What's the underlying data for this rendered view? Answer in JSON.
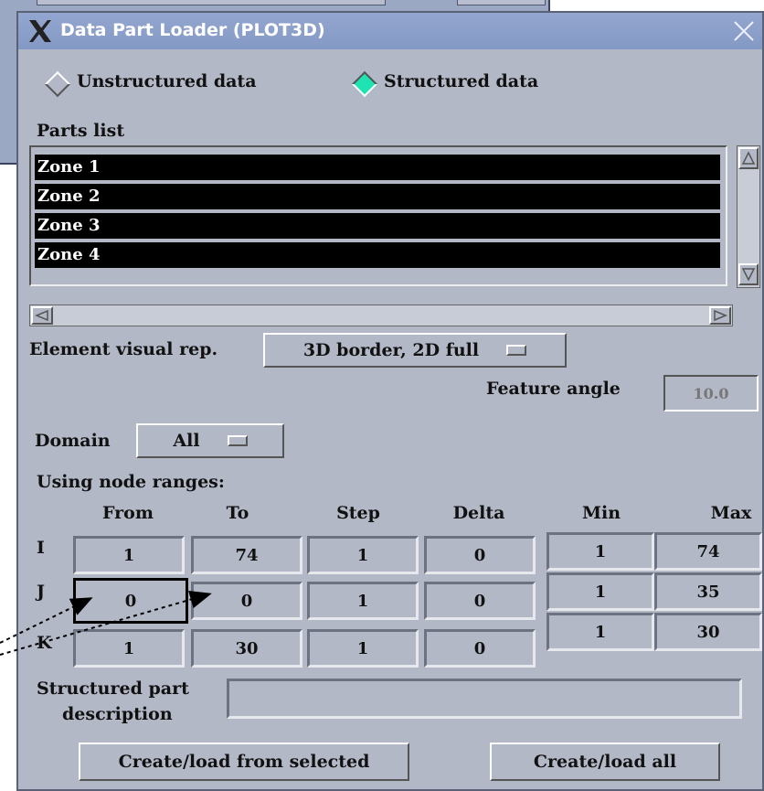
{
  "window": {
    "title": "Data Part Loader (PLOT3D)"
  },
  "data_type": {
    "unstructured_label": "Unstructured data",
    "structured_label": "Structured data",
    "selected": "Structured data"
  },
  "parts": {
    "label": "Parts list",
    "items": [
      "Zone 1",
      "Zone 2",
      "Zone 3",
      "Zone 4"
    ]
  },
  "element_visual": {
    "label": "Element visual rep.",
    "value": "3D border, 2D full"
  },
  "feature_angle": {
    "label": "Feature angle",
    "value": "10.0"
  },
  "domain": {
    "label": "Domain",
    "value": "All"
  },
  "ranges": {
    "label": "Using node ranges:",
    "headers": {
      "from": "From",
      "to": "To",
      "step": "Step",
      "delta": "Delta",
      "min": "Min",
      "max": "Max"
    },
    "rows": [
      {
        "axis": "I",
        "from": "1",
        "to": "74",
        "step": "1",
        "delta": "0",
        "min": "1",
        "max": "74"
      },
      {
        "axis": "J",
        "from": "0",
        "to": "0",
        "step": "1",
        "delta": "0",
        "min": "1",
        "max": "35"
      },
      {
        "axis": "K",
        "from": "1",
        "to": "30",
        "step": "1",
        "delta": "0",
        "min": "1",
        "max": "30"
      }
    ]
  },
  "description": {
    "label_line1": "Structured part",
    "label_line2": "description",
    "value": ""
  },
  "buttons": {
    "create_selected": "Create/load from selected",
    "create_all": "Create/load all"
  }
}
